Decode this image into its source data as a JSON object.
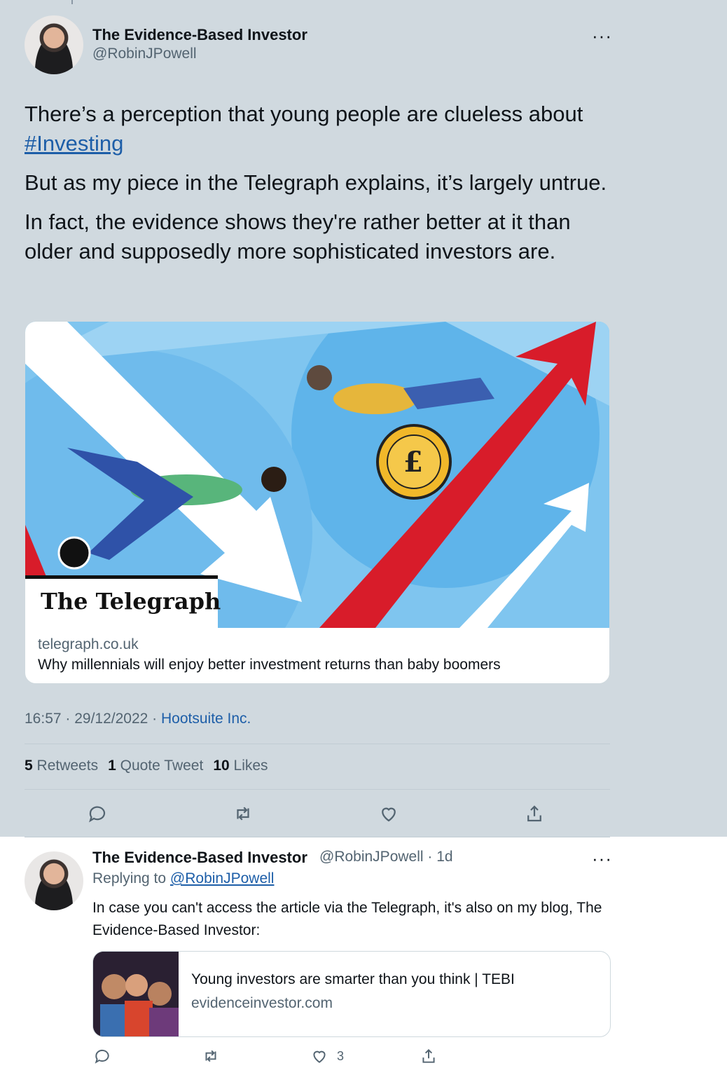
{
  "main_tweet": {
    "author_name": "The Evidence-Based Investor",
    "author_handle": "@RobinJPowell",
    "more_label": "···",
    "text_line1": "There’s a perception that young people are clueless about",
    "hashtag": "#Investing",
    "para2": "But as my piece in the Telegraph explains, it’s largely untrue.",
    "para3": "In fact, the evidence shows they're rather better at it than older and supposedly more sophisticated investors are.",
    "card": {
      "logo_text": "The Telegraph",
      "domain": "telegraph.co.uk",
      "title": "Why millennials will enjoy better investment returns than baby boomers"
    },
    "timestamp": "16:57 · 29/12/2022 · ",
    "source": "Hootsuite Inc.",
    "stats": {
      "retweets_count": "5",
      "retweets_label": "Retweets",
      "quotes_count": "1",
      "quotes_label": "Quote Tweet",
      "likes_count": "10",
      "likes_label": "Likes"
    }
  },
  "reply_tweet": {
    "author_name": "The Evidence-Based Investor",
    "author_handle": "@RobinJPowell · 1d",
    "more_label": "···",
    "replying_prefix": "Replying to ",
    "replying_handle": "@RobinJPowell",
    "text": "In case you can't access the article via the Telegraph, it's also on my blog, The Evidence-Based Investor:",
    "card": {
      "title": "Young investors are smarter than you think | TEBI",
      "domain": "evidenceinvestor.com"
    },
    "likes_count": "3"
  },
  "icons": [
    "reply-icon",
    "retweet-icon",
    "like-icon",
    "share-icon",
    "more-icon"
  ],
  "colors": {
    "link": "#1d5ea8",
    "secondary_text": "#536471",
    "highlight_bg": "#d0d9df"
  }
}
